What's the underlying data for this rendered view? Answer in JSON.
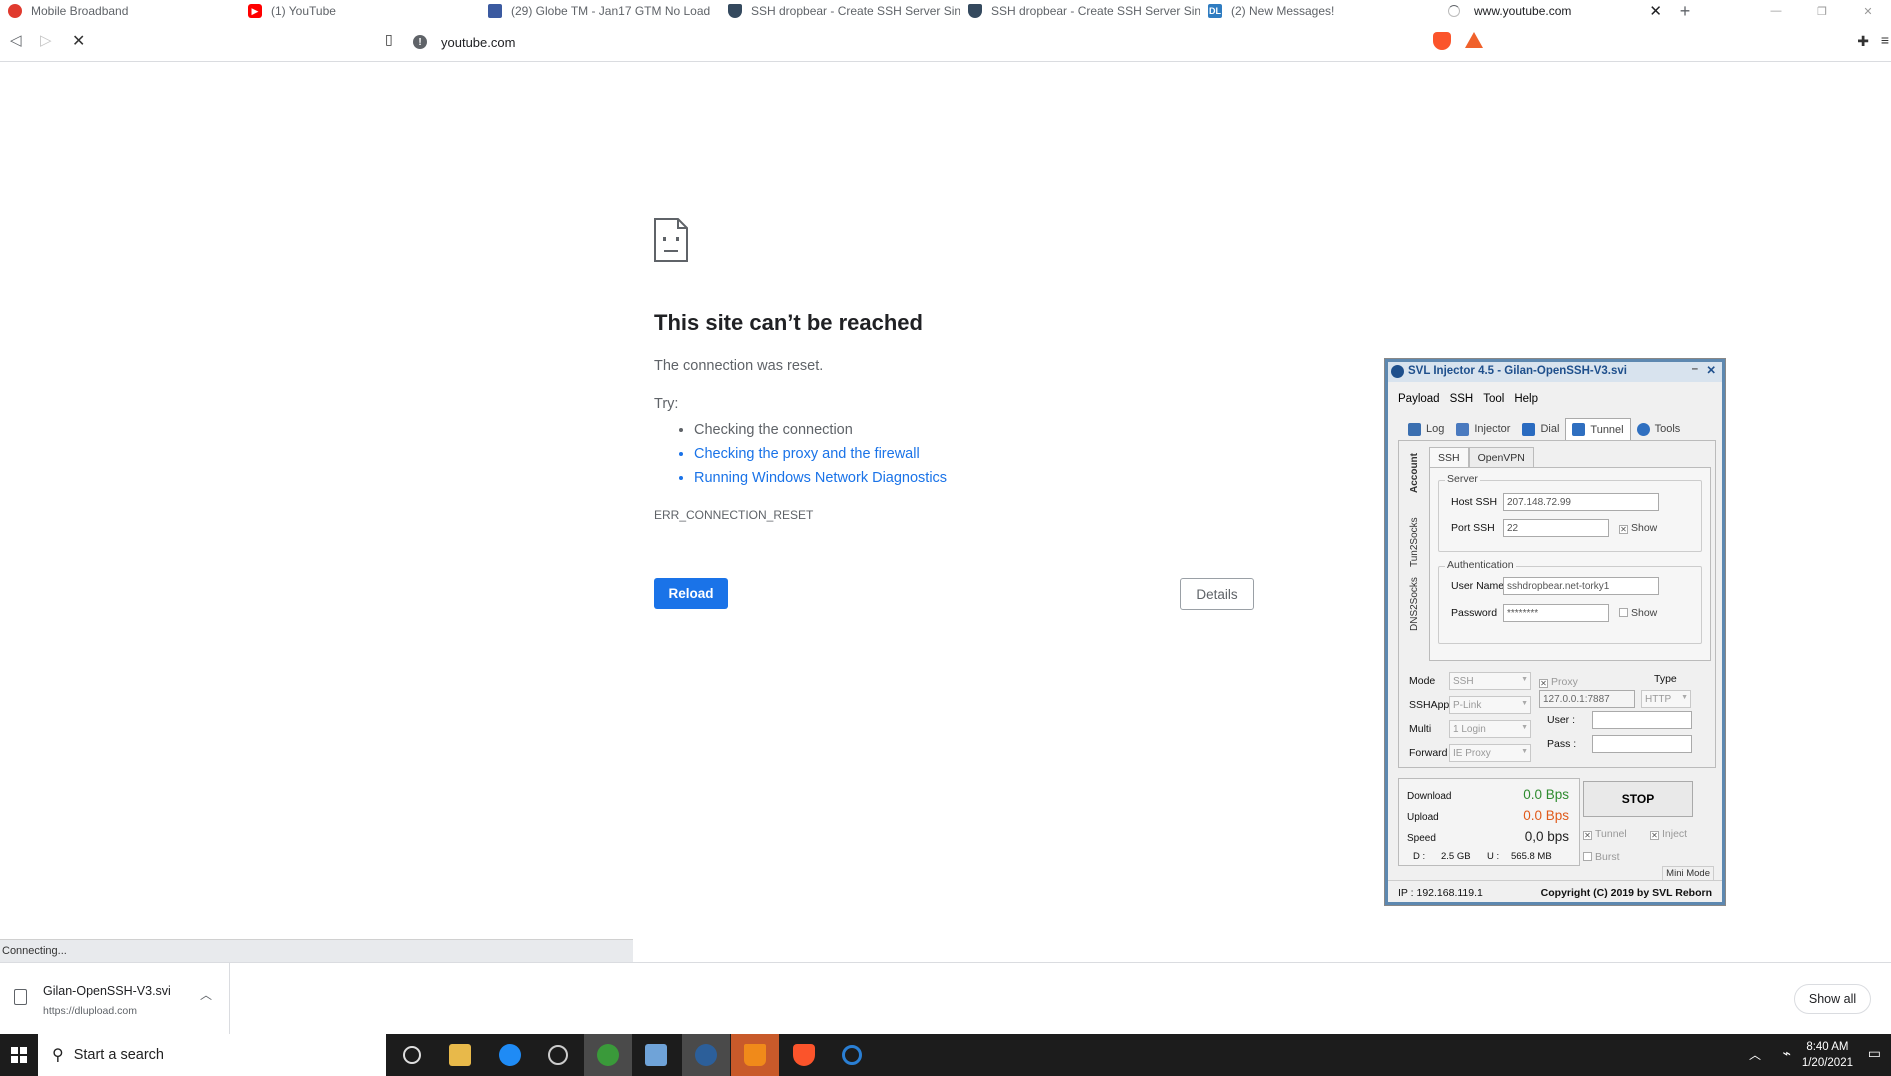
{
  "tabs": [
    {
      "title": "Mobile Broadband",
      "icon": "huawei-icon",
      "color": "#e03a2e"
    },
    {
      "title": "(1) YouTube",
      "icon": "youtube-icon",
      "color": "#ff0000"
    },
    {
      "title": "(29) Globe TM - Jan17 GTM No Load",
      "icon": "globe-shield-icon",
      "color": "#3b5aa0"
    },
    {
      "title": "SSH dropbear - Create SSH Server Sin",
      "icon": "shield-icon",
      "color": "#34495e"
    },
    {
      "title": "SSH dropbear - Create SSH Server Sin",
      "icon": "shield-icon",
      "color": "#34495e"
    },
    {
      "title": "(2) New Messages!",
      "icon": "dl-icon",
      "color": "#2f7cc1",
      "icon_text": "DL"
    },
    {
      "title": "www.youtube.com",
      "icon": "loading-spinner-icon",
      "active": true
    }
  ],
  "address": {
    "url": "youtube.com"
  },
  "error": {
    "title": "This site can’t be reached",
    "subtitle": "The connection was reset.",
    "try_label": "Try:",
    "suggestions": [
      {
        "text": "Checking the connection",
        "link": false
      },
      {
        "text": "Checking the proxy and the firewall",
        "link": true
      },
      {
        "text": "Running Windows Network Diagnostics",
        "link": true
      }
    ],
    "code": "ERR_CONNECTION_RESET",
    "reload_label": "Reload",
    "details_label": "Details"
  },
  "status": {
    "text": "Connecting..."
  },
  "download": {
    "filename": "Gilan-OpenSSH-V3.svi",
    "url": "https://dlupload.com",
    "show_all_label": "Show all"
  },
  "taskbar": {
    "search_placeholder": "Start a search",
    "time": "8:40 AM",
    "date": "1/20/2021"
  },
  "svl": {
    "title": "SVL Injector 4.5 - Gilan-OpenSSH-V3.svi",
    "menu": [
      "Payload",
      "SSH",
      "Tool",
      "Help"
    ],
    "tabs": [
      {
        "label": "Log",
        "color": "#3b6fb0"
      },
      {
        "label": "Injector",
        "color": "#4a7abf"
      },
      {
        "label": "Dial",
        "color": "#2a6bc0"
      },
      {
        "label": "Tunnel",
        "color": "#2f6fc0",
        "active": true
      },
      {
        "label": "Tools",
        "color": "#2f6fc0"
      }
    ],
    "side_tabs": [
      "Account",
      "Tun2Socks",
      "DNS2Socks"
    ],
    "inner_tabs": [
      "SSH",
      "OpenVPN"
    ],
    "server": {
      "group_label": "Server",
      "host_label": "Host SSH",
      "host_value": "207.148.72.99",
      "port_label": "Port SSH",
      "port_value": "22",
      "show_label": "Show"
    },
    "auth": {
      "group_label": "Authentication",
      "user_label": "User Name",
      "user_value": "sshdropbear.net-torky1",
      "pass_label": "Password",
      "pass_value": "********",
      "show_label": "Show"
    },
    "settings": {
      "mode_label": "Mode",
      "mode_value": "SSH",
      "sshapp_label": "SSHApp",
      "sshapp_value": "P-Link",
      "multi_label": "Multi",
      "multi_value": "1 Login",
      "forward_label": "Forward",
      "forward_value": "IE Proxy",
      "proxy_label": "Proxy",
      "proxy_value": "127.0.0.1:7887",
      "type_label": "Type",
      "type_value": "HTTP",
      "user_label": "User :",
      "pass_label": "Pass :"
    },
    "stats": {
      "download_label": "Download",
      "download_value": "0.0 Bps",
      "download_color": "#2e8b2e",
      "upload_label": "Upload",
      "upload_value": "0.0 Bps",
      "upload_color": "#e05a1a",
      "speed_label": "Speed",
      "speed_value": "0,0 bps",
      "d_label": "D :",
      "d_value": "2.5 GB",
      "u_label": "U :",
      "u_value": "565.8 MB"
    },
    "stop_label": "STOP",
    "tunnel_label": "Tunnel",
    "inject_label": "Inject",
    "burst_label": "Burst",
    "mini_mode_label": "Mini Mode",
    "ip_text": "IP : 192.168.119.1",
    "copyright": "Copyright (C) 2019 by SVL Reborn"
  }
}
